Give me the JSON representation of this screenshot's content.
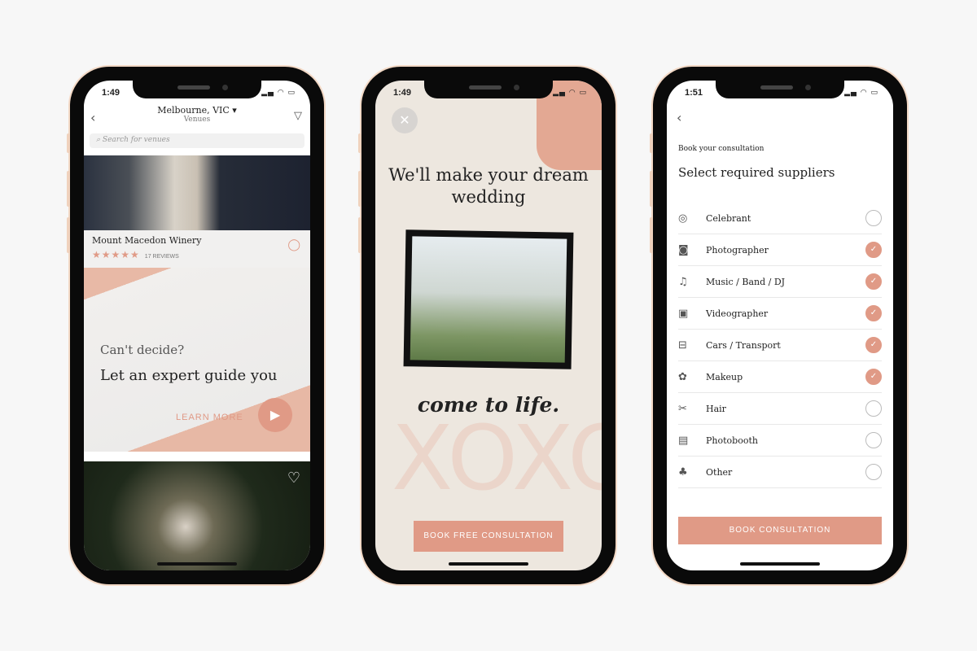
{
  "phone1": {
    "time": "1:49",
    "location": "Melbourne, VIC ▾",
    "subtitle": "Venues",
    "search_placeholder": "Search for venues",
    "venue_name": "Mount Macedon Winery",
    "stars": "★★★★★",
    "rating": 5,
    "reviews": "17 REVIEWS",
    "banner_line1": "Can't decide?",
    "banner_line2": "Let an expert guide you",
    "learn_more": "LEARN MORE"
  },
  "phone2": {
    "time": "1:49",
    "headline": "We'll make your dream wedding",
    "tagline": "come to life.",
    "watermark": "XOXO",
    "cta": "BOOK FREE CONSULTATION"
  },
  "phone3": {
    "time": "1:51",
    "kicker": "Book your consultation",
    "title": "Select required suppliers",
    "suppliers": [
      {
        "label": "Celebrant",
        "icon": "rings-icon",
        "checked": false
      },
      {
        "label": "Photographer",
        "icon": "camera-icon",
        "checked": true
      },
      {
        "label": "Music / Band / DJ",
        "icon": "music-icon",
        "checked": true
      },
      {
        "label": "Videographer",
        "icon": "video-camera-icon",
        "checked": true
      },
      {
        "label": "Cars / Transport",
        "icon": "car-icon",
        "checked": true
      },
      {
        "label": "Makeup",
        "icon": "makeup-icon",
        "checked": true
      },
      {
        "label": "Hair",
        "icon": "scissors-icon",
        "checked": false
      },
      {
        "label": "Photobooth",
        "icon": "film-icon",
        "checked": false
      },
      {
        "label": "Other",
        "icon": "other-icon",
        "checked": false
      }
    ],
    "cta": "BOOK CONSULTATION"
  },
  "colors": {
    "accent": "#e09a86",
    "background": "#f7f7f7"
  }
}
